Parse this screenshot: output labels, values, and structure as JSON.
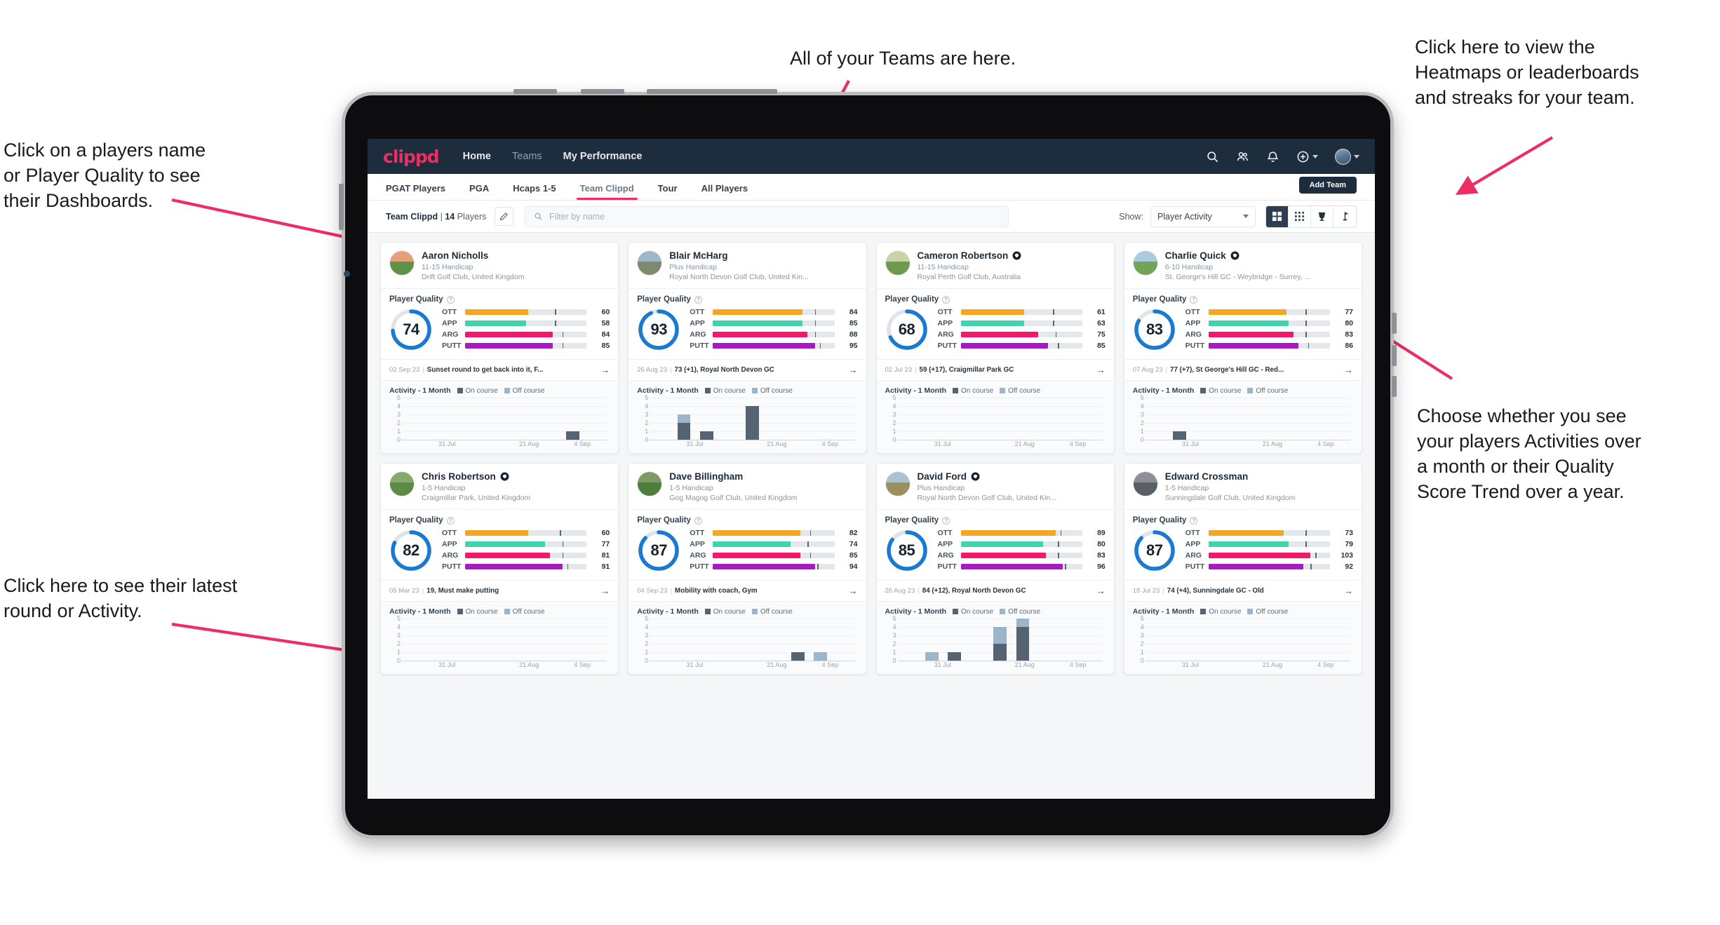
{
  "annotations": [
    {
      "id": "teams",
      "text": "All of your Teams are here."
    },
    {
      "id": "heatmap",
      "text": "Click here to view the\nHeatmaps or leaderboards\nand streaks for your team."
    },
    {
      "id": "names",
      "text": "Click on a players name\nor Player Quality to see\ntheir Dashboards."
    },
    {
      "id": "show",
      "text": "Choose whether you see\nyour players Activities over\na month or their Quality\nScore Trend over a year."
    },
    {
      "id": "round",
      "text": "Click here to see their latest\nround or Activity."
    }
  ],
  "topnav": {
    "logo": "clippd",
    "links": [
      {
        "label": "Home",
        "dim": false
      },
      {
        "label": "Teams",
        "dim": true
      },
      {
        "label": "My Performance",
        "dim": false
      }
    ],
    "icons": [
      "search-icon",
      "people-icon",
      "bell-icon",
      "plus-circle-icon",
      "avatar"
    ]
  },
  "tabs": [
    {
      "label": "PGAT Players",
      "active": false
    },
    {
      "label": "PGA",
      "active": false
    },
    {
      "label": "Hcaps 1-5",
      "active": false
    },
    {
      "label": "Team Clippd",
      "active": true
    },
    {
      "label": "Tour",
      "active": false
    },
    {
      "label": "All Players",
      "active": false
    }
  ],
  "add_team_label": "Add Team",
  "filterbar": {
    "team_name": "Team Clippd",
    "separator": "|",
    "player_count": "14",
    "players_word": "Players",
    "edit_icon": "pencil-icon",
    "search_placeholder": "Filter by name",
    "search_value": "",
    "show_label": "Show:",
    "show_value": "Player Activity",
    "show_options": [
      "Player Activity",
      "Quality Score Trend"
    ],
    "views": [
      {
        "name": "grid-view",
        "active": true
      },
      {
        "name": "dense-grid-view",
        "active": false
      },
      {
        "name": "heatmap-view",
        "active": false
      },
      {
        "name": "leaderboard-view",
        "active": false
      }
    ]
  },
  "card_labels": {
    "player_quality": "Player Quality",
    "activity": "Activity - 1 Month",
    "legend_on": "On course",
    "legend_off": "Off course",
    "metrics": [
      "OTT",
      "APP",
      "ARG",
      "PUTT"
    ]
  },
  "colors": {
    "accent": "#ee2e62",
    "navy": "#1d2d3e",
    "ring": "#1a79d0",
    "ott": "#f5a623",
    "app": "#3ed4b0",
    "arg": "#f4186b",
    "putt": "#a819c4",
    "on_course": "#566472",
    "off_course": "#9db4c9"
  },
  "chart_data": {
    "type": "bar",
    "title": "Activity - 1 Month",
    "xlabel": "",
    "ylabel": "",
    "ylim": [
      0,
      5
    ],
    "yticks": [
      0,
      1,
      2,
      3,
      4,
      5
    ],
    "x_ticklabels": [
      "31 Jul",
      "21 Aug",
      "4 Sep"
    ],
    "legend": [
      "On course",
      "Off course"
    ],
    "legend_position": "top",
    "grid": true,
    "stacked": true,
    "bins": 9,
    "panels": [
      {
        "player": "Aaron Nicholls",
        "on_course": [
          0,
          0,
          0,
          0,
          0,
          0,
          0,
          1,
          0
        ],
        "off_course": [
          0,
          0,
          0,
          0,
          0,
          0,
          0,
          0,
          0
        ]
      },
      {
        "player": "Blair McHarg",
        "on_course": [
          0,
          2,
          1,
          0,
          4,
          0,
          0,
          0,
          0
        ],
        "off_course": [
          0,
          1,
          0,
          0,
          0,
          0,
          0,
          0,
          0
        ]
      },
      {
        "player": "Cameron Robertson",
        "on_course": [
          0,
          0,
          0,
          0,
          0,
          0,
          0,
          0,
          0
        ],
        "off_course": [
          0,
          0,
          0,
          0,
          0,
          0,
          0,
          0,
          0
        ]
      },
      {
        "player": "Charlie Quick",
        "on_course": [
          0,
          1,
          0,
          0,
          0,
          0,
          0,
          0,
          0
        ],
        "off_course": [
          0,
          0,
          0,
          0,
          0,
          0,
          0,
          0,
          0
        ]
      },
      {
        "player": "Chris Robertson",
        "on_course": [
          0,
          0,
          0,
          0,
          0,
          0,
          0,
          0,
          0
        ],
        "off_course": [
          0,
          0,
          0,
          0,
          0,
          0,
          0,
          0,
          0
        ]
      },
      {
        "player": "Dave Billingham",
        "on_course": [
          0,
          0,
          0,
          0,
          0,
          0,
          1,
          0,
          0
        ],
        "off_course": [
          0,
          0,
          0,
          0,
          0,
          0,
          0,
          1,
          0
        ]
      },
      {
        "player": "David Ford",
        "on_course": [
          0,
          0,
          1,
          0,
          2,
          4,
          0,
          0,
          0
        ],
        "off_course": [
          0,
          1,
          0,
          0,
          2,
          1,
          0,
          0,
          0
        ]
      },
      {
        "player": "Edward Crossman",
        "on_course": [
          0,
          0,
          0,
          0,
          0,
          0,
          0,
          0,
          0
        ],
        "off_course": [
          0,
          0,
          0,
          0,
          0,
          0,
          0,
          0,
          0
        ]
      }
    ]
  },
  "players": [
    {
      "name": "Aaron Nicholls",
      "verified": false,
      "handicap": "11-15 Handicap",
      "club": "Drift Golf Club, United Kingdom",
      "score": 74,
      "metrics": [
        {
          "label": "OTT",
          "value": 60,
          "pct": 52,
          "tick": 74
        },
        {
          "label": "APP",
          "value": 58,
          "pct": 50,
          "tick": 74
        },
        {
          "label": "ARG",
          "value": 84,
          "pct": 72,
          "tick": 80
        },
        {
          "label": "PUTT",
          "value": 85,
          "pct": 72,
          "tick": 80
        }
      ],
      "round_date": "02 Sep 23",
      "round_text": "Sunset round to get back into it, F...",
      "avatar": {
        "sky": "#e3a07a",
        "ground": "#5f9248"
      }
    },
    {
      "name": "Blair McHarg",
      "verified": false,
      "handicap": "Plus Handicap",
      "club": "Royal North Devon Golf Club, United Kin...",
      "score": 93,
      "metrics": [
        {
          "label": "OTT",
          "value": 84,
          "pct": 74,
          "tick": 84
        },
        {
          "label": "APP",
          "value": 85,
          "pct": 74,
          "tick": 84
        },
        {
          "label": "ARG",
          "value": 88,
          "pct": 78,
          "tick": 84
        },
        {
          "label": "PUTT",
          "value": 95,
          "pct": 84,
          "tick": 88
        }
      ],
      "round_date": "26 Aug 23",
      "round_text": "73 (+1), Royal North Devon GC",
      "avatar": {
        "sky": "#9fb8c9",
        "ground": "#7d8a6d"
      }
    },
    {
      "name": "Cameron Robertson",
      "verified": true,
      "handicap": "11-15 Handicap",
      "club": "Royal Perth Golf Club, Australia",
      "score": 68,
      "metrics": [
        {
          "label": "OTT",
          "value": 61,
          "pct": 52,
          "tick": 76
        },
        {
          "label": "APP",
          "value": 63,
          "pct": 52,
          "tick": 76
        },
        {
          "label": "ARG",
          "value": 75,
          "pct": 64,
          "tick": 78
        },
        {
          "label": "PUTT",
          "value": 85,
          "pct": 72,
          "tick": 80
        }
      ],
      "round_date": "02 Jul 23",
      "round_text": "59 (+17), Craigmillar Park GC",
      "avatar": {
        "sky": "#c9d3a8",
        "ground": "#6f9a4d"
      }
    },
    {
      "name": "Charlie Quick",
      "verified": true,
      "handicap": "6-10 Handicap",
      "club": "St. George's Hill GC - Weybridge - Surrey, ...",
      "score": 83,
      "metrics": [
        {
          "label": "OTT",
          "value": 77,
          "pct": 64,
          "tick": 80
        },
        {
          "label": "APP",
          "value": 80,
          "pct": 66,
          "tick": 80
        },
        {
          "label": "ARG",
          "value": 83,
          "pct": 70,
          "tick": 80
        },
        {
          "label": "PUTT",
          "value": 86,
          "pct": 74,
          "tick": 82
        }
      ],
      "round_date": "07 Aug 23",
      "round_text": "77 (+7), St George's Hill GC - Red...",
      "avatar": {
        "sky": "#a9cbe0",
        "ground": "#74a356"
      }
    },
    {
      "name": "Chris Robertson",
      "verified": true,
      "handicap": "1-5 Handicap",
      "club": "Craigmillar Park, United Kingdom",
      "score": 82,
      "metrics": [
        {
          "label": "OTT",
          "value": 60,
          "pct": 52,
          "tick": 78
        },
        {
          "label": "APP",
          "value": 77,
          "pct": 66,
          "tick": 80
        },
        {
          "label": "ARG",
          "value": 81,
          "pct": 70,
          "tick": 80
        },
        {
          "label": "PUTT",
          "value": 91,
          "pct": 80,
          "tick": 84
        }
      ],
      "round_date": "05 Mar 23",
      "round_text": "19, Must make putting",
      "avatar": {
        "sky": "#88a86c",
        "ground": "#5d8a46"
      }
    },
    {
      "name": "Dave Billingham",
      "verified": false,
      "handicap": "1-5 Handicap",
      "club": "Gog Magog Golf Club, United Kingdom",
      "score": 87,
      "metrics": [
        {
          "label": "OTT",
          "value": 82,
          "pct": 72,
          "tick": 80
        },
        {
          "label": "APP",
          "value": 74,
          "pct": 64,
          "tick": 78
        },
        {
          "label": "ARG",
          "value": 85,
          "pct": 72,
          "tick": 80
        },
        {
          "label": "PUTT",
          "value": 94,
          "pct": 84,
          "tick": 86
        }
      ],
      "round_date": "04 Sep 23",
      "round_text": "Mobility with coach, Gym",
      "avatar": {
        "sky": "#7f9a63",
        "ground": "#4f7d3c"
      }
    },
    {
      "name": "David Ford",
      "verified": true,
      "handicap": "Plus Handicap",
      "club": "Royal North Devon Golf Club, United Kin...",
      "score": 85,
      "metrics": [
        {
          "label": "OTT",
          "value": 89,
          "pct": 78,
          "tick": 82
        },
        {
          "label": "APP",
          "value": 80,
          "pct": 68,
          "tick": 80
        },
        {
          "label": "ARG",
          "value": 83,
          "pct": 70,
          "tick": 80
        },
        {
          "label": "PUTT",
          "value": 96,
          "pct": 84,
          "tick": 86
        }
      ],
      "round_date": "26 Aug 23",
      "round_text": "84 (+12), Royal North Devon GC",
      "avatar": {
        "sky": "#a7c3d6",
        "ground": "#9a8f5e"
      }
    },
    {
      "name": "Edward Crossman",
      "verified": false,
      "handicap": "1-5 Handicap",
      "club": "Sunningdale Golf Club, United Kingdom",
      "score": 87,
      "metrics": [
        {
          "label": "OTT",
          "value": 73,
          "pct": 62,
          "tick": 80
        },
        {
          "label": "APP",
          "value": 79,
          "pct": 66,
          "tick": 80
        },
        {
          "label": "ARG",
          "value": 103,
          "pct": 84,
          "tick": 88
        },
        {
          "label": "PUTT",
          "value": 92,
          "pct": 78,
          "tick": 84
        }
      ],
      "round_date": "18 Jul 23",
      "round_text": "74 (+4), Sunningdale GC - Old",
      "avatar": {
        "sky": "#8c8f95",
        "ground": "#5a5f66"
      }
    }
  ]
}
